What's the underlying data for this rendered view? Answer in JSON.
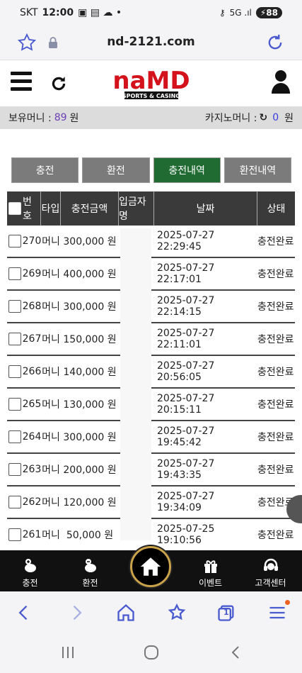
{
  "status_bar": {
    "carrier": "SKT",
    "time": "12:00",
    "battery": "88"
  },
  "browser": {
    "url": "nd-2121.com"
  },
  "site": {
    "logo_text": "naMD",
    "logo_sub": "SPORTS & CASINO"
  },
  "balance": {
    "label": "보유머니 :",
    "amount": "89",
    "unit": "원",
    "casino_label": "카지노머니 :",
    "casino_amount": "0",
    "casino_unit": "원"
  },
  "tabs": [
    {
      "label": "충전",
      "active": false
    },
    {
      "label": "환전",
      "active": false
    },
    {
      "label": "충전내역",
      "active": true
    },
    {
      "label": "환전내역",
      "active": false
    }
  ],
  "table": {
    "headers": [
      "번호",
      "타입",
      "충전금액",
      "입금자명",
      "날짜",
      "상태"
    ],
    "rows": [
      {
        "no": "270",
        "type": "머니",
        "amount": "300,000 원",
        "date": "2025-07-27 22:29:45",
        "status": "충전완료"
      },
      {
        "no": "269",
        "type": "머니",
        "amount": "400,000 원",
        "date": "2025-07-27 22:17:01",
        "status": "충전완료"
      },
      {
        "no": "268",
        "type": "머니",
        "amount": "300,000 원",
        "date": "2025-07-27 22:14:15",
        "status": "충전완료"
      },
      {
        "no": "267",
        "type": "머니",
        "amount": "150,000 원",
        "date": "2025-07-27 22:11:01",
        "status": "충전완료"
      },
      {
        "no": "266",
        "type": "머니",
        "amount": "140,000 원",
        "date": "2025-07-27 20:56:05",
        "status": "충전완료"
      },
      {
        "no": "265",
        "type": "머니",
        "amount": "130,000 원",
        "date": "2025-07-27 20:15:11",
        "status": "충전완료"
      },
      {
        "no": "264",
        "type": "머니",
        "amount": "300,000 원",
        "date": "2025-07-27 19:45:42",
        "status": "충전완료"
      },
      {
        "no": "263",
        "type": "머니",
        "amount": "200,000 원",
        "date": "2025-07-27 19:43:35",
        "status": "충전완료"
      },
      {
        "no": "262",
        "type": "머니",
        "amount": "120,000 원",
        "date": "2025-07-27 19:34:09",
        "status": "충전완료"
      },
      {
        "no": "261",
        "type": "머니",
        "amount": "50,000 원",
        "date": "2025-07-25 19:10:56",
        "status": "충전완료"
      }
    ]
  },
  "bottom_nav": [
    {
      "label": "충전"
    },
    {
      "label": "환전"
    },
    {
      "label": ""
    },
    {
      "label": "이벤트"
    },
    {
      "label": "고객센터"
    }
  ],
  "browser_nav": {
    "tab_count": "1"
  },
  "colors": {
    "active_tab": "#1f6b32",
    "tab": "#7b7b7b",
    "header": "#3a3a3a",
    "logo_red": "#d4121b",
    "accent": "#3a3ae0"
  }
}
